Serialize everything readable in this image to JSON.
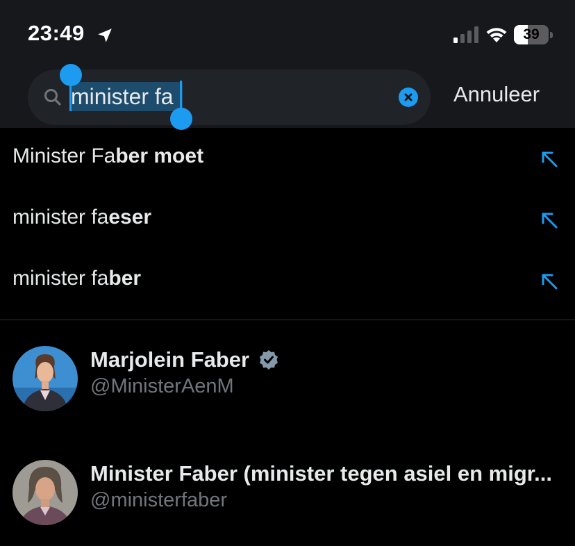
{
  "status_bar": {
    "time": "23:49",
    "battery_level": "39",
    "battery_fraction": 0.39
  },
  "search": {
    "query": "minister fa",
    "cancel_label": "Annuleer"
  },
  "suggestions": [
    {
      "prefix": "Minister Fa",
      "completion": "ber moet"
    },
    {
      "prefix": "minister fa",
      "completion": "eser"
    },
    {
      "prefix": "minister fa",
      "completion": "ber"
    }
  ],
  "users": [
    {
      "name": "Marjolein Faber",
      "handle": "@MinisterAenM",
      "verified": true
    },
    {
      "name": "Minister Faber (minister tegen asiel en migr...",
      "handle": "@ministerfaber",
      "verified": false
    }
  ],
  "colors": {
    "accent": "#1d9bf0",
    "background": "#000000",
    "header": "#16181c",
    "muted_text": "#71767b"
  }
}
